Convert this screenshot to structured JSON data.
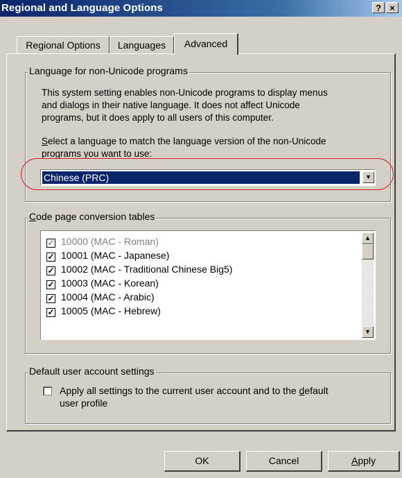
{
  "window": {
    "title": "Regional and Language Options",
    "help_btn": "?",
    "close_btn": "×"
  },
  "tabs": [
    {
      "label": "Regional Options",
      "active": false
    },
    {
      "label": "Languages",
      "active": false
    },
    {
      "label": "Advanced",
      "active": true
    }
  ],
  "non_unicode": {
    "legend": "Language for non-Unicode programs",
    "description": [
      "This system setting enables non-Unicode programs to display menus",
      "and dialogs in their native language. It does not affect Unicode",
      "programs, but it does apply to all users of this computer."
    ],
    "select_label_accel": "S",
    "select_label_rest": "elect a language to match the language version of the non-Unicode",
    "select_label_line2": "programs you want to use:",
    "selected_language": "Chinese (PRC)",
    "highlight_color": "#d82020"
  },
  "code_pages": {
    "legend_accel": "C",
    "legend_rest": "ode page conversion tables",
    "items": [
      {
        "label": "10000 (MAC - Roman)",
        "checked": true,
        "grayed": true
      },
      {
        "label": "10001 (MAC - Japanese)",
        "checked": true,
        "grayed": false
      },
      {
        "label": "10002 (MAC - Traditional Chinese Big5)",
        "checked": true,
        "grayed": false
      },
      {
        "label": "10003 (MAC - Korean)",
        "checked": true,
        "grayed": false
      },
      {
        "label": "10004 (MAC - Arabic)",
        "checked": true,
        "grayed": false
      },
      {
        "label": "10005 (MAC - Hebrew)",
        "checked": true,
        "grayed": false
      }
    ],
    "check_glyph": "✓"
  },
  "default_user": {
    "legend": "Default user account settings",
    "checkbox_checked": false,
    "label_part1": "Apply all settings to the current user account and to the ",
    "label_accel": "d",
    "label_part2": "efault",
    "label_line2": "user profile"
  },
  "buttons": {
    "ok": "OK",
    "cancel": "Cancel",
    "apply_accel": "A",
    "apply_rest": "pply"
  },
  "icons": {
    "scroll_up": "▲",
    "scroll_down": "▼",
    "dropdown": "▼"
  }
}
